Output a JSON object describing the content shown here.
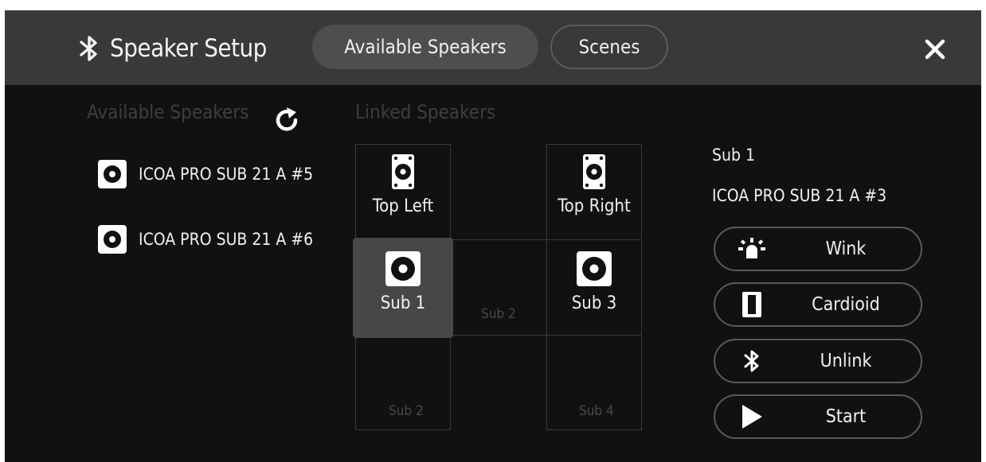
{
  "header": {
    "title": "Speaker Setup",
    "bluetooth_icon": "bluetooth-icon",
    "tabs": [
      {
        "label": "Available Speakers",
        "active": true
      },
      {
        "label": "Scenes",
        "active": false
      }
    ],
    "close_icon": "close-icon"
  },
  "available": {
    "heading": "Available Speakers",
    "refresh_icon": "refresh-icon",
    "items": [
      {
        "label": "ICOA PRO SUB 21 A #5",
        "icon": "speaker-icon"
      },
      {
        "label": "ICOA PRO SUB 21 A #6",
        "icon": "speaker-icon"
      }
    ]
  },
  "linked": {
    "heading": "Linked Speakers",
    "cells": [
      {
        "label": "Top Left",
        "icon": "tower-speaker-icon"
      },
      {
        "label": "Top Right",
        "icon": "tower-speaker-icon"
      },
      {
        "label": "Sub 1",
        "icon": "subwoofer-icon",
        "selected": true
      },
      {
        "label": "Sub 3",
        "icon": "subwoofer-icon"
      }
    ],
    "empty_slots": [
      "Sub 2",
      "Sub 2",
      "Sub 4"
    ]
  },
  "detail": {
    "name": "Sub 1",
    "model": "ICOA PRO SUB 21 A #3",
    "actions": [
      {
        "label": "Wink",
        "icon": "wink-light-icon"
      },
      {
        "label": "Cardioid",
        "icon": "cardioid-icon"
      },
      {
        "label": "Unlink",
        "icon": "bluetooth-icon"
      },
      {
        "label": "Start",
        "icon": "play-icon"
      }
    ]
  },
  "colors": {
    "background": "#111111",
    "header": "#393939",
    "active_tab": "#4e4e4e",
    "selected_cell": "#474747",
    "text": "#f0f0f0",
    "muted_text": "#3e3e3e"
  }
}
